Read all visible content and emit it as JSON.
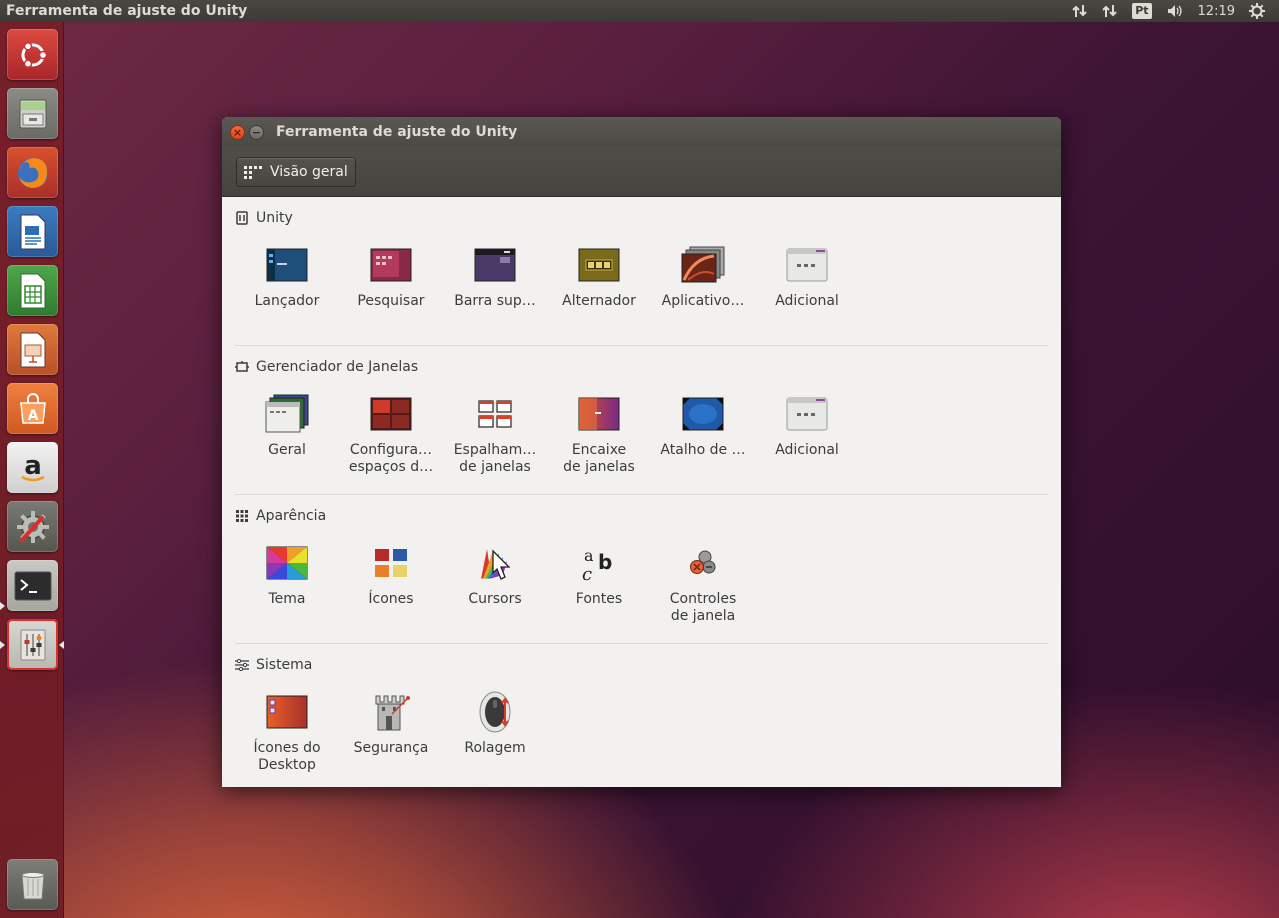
{
  "panel": {
    "app_title": "Ferramenta de ajuste do Unity",
    "keyboard_layout": "Pt",
    "clock": "12:19"
  },
  "launcher": {
    "apps": [
      "ubuntu-dash",
      "files",
      "firefox",
      "libreoffice-writer",
      "libreoffice-calc",
      "libreoffice-impress",
      "software-center",
      "amazon",
      "system-settings",
      "terminal",
      "unity-tweak-tool",
      "trash"
    ]
  },
  "window": {
    "title": "Ferramenta de ajuste do Unity",
    "toolbar": {
      "overview_label": "Visão geral"
    },
    "sections": [
      {
        "title": "Unity",
        "items": [
          {
            "label": "Lançador",
            "icon": "launcher-icon"
          },
          {
            "label": "Pesquisar",
            "icon": "search-icon"
          },
          {
            "label": "Barra sup…",
            "icon": "top-bar-icon"
          },
          {
            "label": "Alternador",
            "icon": "switcher-icon"
          },
          {
            "label": "Aplicativo…",
            "icon": "webapps-icon"
          },
          {
            "label": "Adicional",
            "icon": "additional-icon"
          }
        ]
      },
      {
        "title": "Gerenciador de Janelas",
        "items": [
          {
            "label": "Geral",
            "icon": "general-icon"
          },
          {
            "label": "Configura…\nespaços d…",
            "icon": "workspace-icon"
          },
          {
            "label": "Espalham…\nde janelas",
            "icon": "window-spread-icon"
          },
          {
            "label": "Encaixe\nde janelas",
            "icon": "window-snapping-icon"
          },
          {
            "label": "Atalho de …",
            "icon": "hotcorners-icon"
          },
          {
            "label": "Adicional",
            "icon": "additional-icon"
          }
        ]
      },
      {
        "title": "Aparência",
        "items": [
          {
            "label": "Tema",
            "icon": "theme-icon"
          },
          {
            "label": "Ícones",
            "icon": "icons-icon"
          },
          {
            "label": "Cursors",
            "icon": "cursors-icon"
          },
          {
            "label": "Fontes",
            "icon": "fonts-icon"
          },
          {
            "label": "Controles\nde janela",
            "icon": "window-controls-icon"
          }
        ]
      },
      {
        "title": "Sistema",
        "items": [
          {
            "label": "Ícones do\nDesktop",
            "icon": "desktop-icons-icon"
          },
          {
            "label": "Segurança",
            "icon": "security-icon"
          },
          {
            "label": "Rolagem",
            "icon": "scrolling-icon"
          }
        ]
      }
    ]
  },
  "colors": {
    "ubuntu_orange": "#dd4814",
    "panel_bg": "#3b3a36",
    "window_bg": "#f2f1f0"
  }
}
